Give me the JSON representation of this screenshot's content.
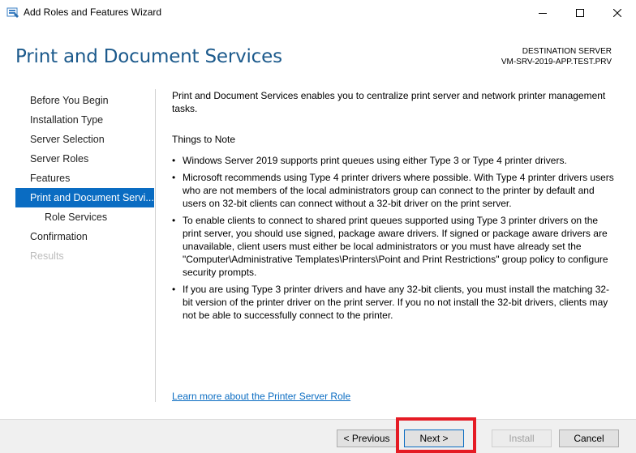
{
  "window": {
    "title": "Add Roles and Features Wizard"
  },
  "header": {
    "page_title": "Print and Document Services",
    "destination_label": "DESTINATION SERVER",
    "destination_server": "VM-SRV-2019-APP.TEST.PRV"
  },
  "sidebar": {
    "items": [
      {
        "label": "Before You Begin",
        "state": "normal"
      },
      {
        "label": "Installation Type",
        "state": "normal"
      },
      {
        "label": "Server Selection",
        "state": "normal"
      },
      {
        "label": "Server Roles",
        "state": "normal"
      },
      {
        "label": "Features",
        "state": "normal"
      },
      {
        "label": "Print and Document Servi...",
        "state": "active"
      },
      {
        "label": "Role Services",
        "state": "sub"
      },
      {
        "label": "Confirmation",
        "state": "normal"
      },
      {
        "label": "Results",
        "state": "disabled"
      }
    ]
  },
  "content": {
    "intro": "Print and Document Services enables you to centralize print server and network printer management tasks.",
    "notes_heading": "Things to Note",
    "bullets": [
      "Windows Server 2019 supports print queues using either Type 3 or Type 4 printer drivers.",
      "Microsoft recommends using Type 4 printer drivers where possible. With Type 4 printer drivers users who are not members of the local administrators group can connect to the printer by default and users on 32-bit clients can connect without a 32-bit driver on the print server.",
      "To enable clients to connect to shared print queues supported using Type 3 printer drivers on the print server, you should use signed, package aware drivers. If signed or package aware drivers are unavailable, client users must either be local administrators or you must have already set the \"Computer\\Administrative Templates\\Printers\\Point and Print Restrictions\" group policy to configure security prompts.",
      "If you are using Type 3 printer drivers and have any 32-bit clients, you must install the matching 32-bit version of the printer driver on the print server. If you no not install the 32-bit drivers, clients may not be able to successfully connect to the printer."
    ],
    "learn_more": "Learn more about the Printer Server Role"
  },
  "footer": {
    "previous": "< Previous",
    "next": "Next >",
    "install": "Install",
    "cancel": "Cancel"
  },
  "colors": {
    "accent": "#0a6cc2",
    "title": "#1c5a8c",
    "highlight": "#e51b24"
  },
  "icons": {
    "app": "server-manager-icon",
    "minimize": "minimize-icon",
    "maximize": "maximize-icon",
    "close": "close-icon"
  }
}
